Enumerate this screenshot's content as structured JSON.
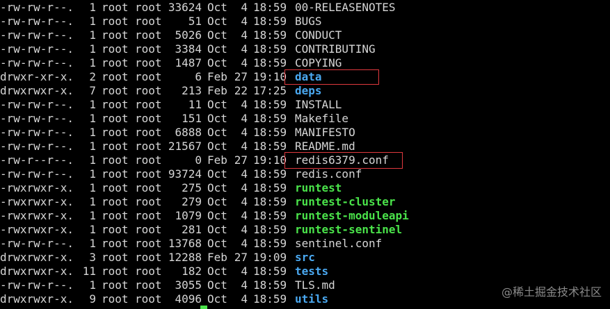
{
  "listing": [
    {
      "perm": "-rw-rw-r--.",
      "links": "1",
      "owner": "root",
      "group": "root",
      "size": "33624",
      "month": "Oct",
      "day": "4",
      "time": "18:59",
      "name": "00-RELEASENOTES",
      "kind": "file"
    },
    {
      "perm": "-rw-rw-r--.",
      "links": "1",
      "owner": "root",
      "group": "root",
      "size": "51",
      "month": "Oct",
      "day": "4",
      "time": "18:59",
      "name": "BUGS",
      "kind": "file"
    },
    {
      "perm": "-rw-rw-r--.",
      "links": "1",
      "owner": "root",
      "group": "root",
      "size": "5026",
      "month": "Oct",
      "day": "4",
      "time": "18:59",
      "name": "CONDUCT",
      "kind": "file"
    },
    {
      "perm": "-rw-rw-r--.",
      "links": "1",
      "owner": "root",
      "group": "root",
      "size": "3384",
      "month": "Oct",
      "day": "4",
      "time": "18:59",
      "name": "CONTRIBUTING",
      "kind": "file"
    },
    {
      "perm": "-rw-rw-r--.",
      "links": "1",
      "owner": "root",
      "group": "root",
      "size": "1487",
      "month": "Oct",
      "day": "4",
      "time": "18:59",
      "name": "COPYING",
      "kind": "file"
    },
    {
      "perm": "drwxr-xr-x.",
      "links": "2",
      "owner": "root",
      "group": "root",
      "size": "6",
      "month": "Feb",
      "day": "27",
      "time": "19:10",
      "name": "data",
      "kind": "dir"
    },
    {
      "perm": "drwxrwxr-x.",
      "links": "7",
      "owner": "root",
      "group": "root",
      "size": "213",
      "month": "Feb",
      "day": "22",
      "time": "17:25",
      "name": "deps",
      "kind": "dir"
    },
    {
      "perm": "-rw-rw-r--.",
      "links": "1",
      "owner": "root",
      "group": "root",
      "size": "11",
      "month": "Oct",
      "day": "4",
      "time": "18:59",
      "name": "INSTALL",
      "kind": "file"
    },
    {
      "perm": "-rw-rw-r--.",
      "links": "1",
      "owner": "root",
      "group": "root",
      "size": "151",
      "month": "Oct",
      "day": "4",
      "time": "18:59",
      "name": "Makefile",
      "kind": "file"
    },
    {
      "perm": "-rw-rw-r--.",
      "links": "1",
      "owner": "root",
      "group": "root",
      "size": "6888",
      "month": "Oct",
      "day": "4",
      "time": "18:59",
      "name": "MANIFESTO",
      "kind": "file"
    },
    {
      "perm": "-rw-rw-r--.",
      "links": "1",
      "owner": "root",
      "group": "root",
      "size": "21567",
      "month": "Oct",
      "day": "4",
      "time": "18:59",
      "name": "README.md",
      "kind": "file"
    },
    {
      "perm": "-rw-r--r--.",
      "links": "1",
      "owner": "root",
      "group": "root",
      "size": "0",
      "month": "Feb",
      "day": "27",
      "time": "19:10",
      "name": "redis6379.conf",
      "kind": "file"
    },
    {
      "perm": "-rw-rw-r--.",
      "links": "1",
      "owner": "root",
      "group": "root",
      "size": "93724",
      "month": "Oct",
      "day": "4",
      "time": "18:59",
      "name": "redis.conf",
      "kind": "file"
    },
    {
      "perm": "-rwxrwxr-x.",
      "links": "1",
      "owner": "root",
      "group": "root",
      "size": "275",
      "month": "Oct",
      "day": "4",
      "time": "18:59",
      "name": "runtest",
      "kind": "exe"
    },
    {
      "perm": "-rwxrwxr-x.",
      "links": "1",
      "owner": "root",
      "group": "root",
      "size": "279",
      "month": "Oct",
      "day": "4",
      "time": "18:59",
      "name": "runtest-cluster",
      "kind": "exe"
    },
    {
      "perm": "-rwxrwxr-x.",
      "links": "1",
      "owner": "root",
      "group": "root",
      "size": "1079",
      "month": "Oct",
      "day": "4",
      "time": "18:59",
      "name": "runtest-moduleapi",
      "kind": "exe"
    },
    {
      "perm": "-rwxrwxr-x.",
      "links": "1",
      "owner": "root",
      "group": "root",
      "size": "281",
      "month": "Oct",
      "day": "4",
      "time": "18:59",
      "name": "runtest-sentinel",
      "kind": "exe"
    },
    {
      "perm": "-rw-rw-r--.",
      "links": "1",
      "owner": "root",
      "group": "root",
      "size": "13768",
      "month": "Oct",
      "day": "4",
      "time": "18:59",
      "name": "sentinel.conf",
      "kind": "file"
    },
    {
      "perm": "drwxrwxr-x.",
      "links": "3",
      "owner": "root",
      "group": "root",
      "size": "12288",
      "month": "Feb",
      "day": "27",
      "time": "19:09",
      "name": "src",
      "kind": "dir"
    },
    {
      "perm": "drwxrwxr-x.",
      "links": "11",
      "owner": "root",
      "group": "root",
      "size": "182",
      "month": "Oct",
      "day": "4",
      "time": "18:59",
      "name": "tests",
      "kind": "dir"
    },
    {
      "perm": "-rw-rw-r--.",
      "links": "1",
      "owner": "root",
      "group": "root",
      "size": "3055",
      "month": "Oct",
      "day": "4",
      "time": "18:59",
      "name": "TLS.md",
      "kind": "file"
    },
    {
      "perm": "drwxrwxr-x.",
      "links": "9",
      "owner": "root",
      "group": "root",
      "size": "4096",
      "month": "Oct",
      "day": "4",
      "time": "18:59",
      "name": "utils",
      "kind": "dir"
    }
  ],
  "watermark": "@稀土掘金技术社区",
  "colors": {
    "background": "#000000",
    "text": "#d6d6d6",
    "directory": "#4aa8f0",
    "executable": "#4ae34a",
    "highlight_border": "#e0393e",
    "cursor": "#4ae34a"
  }
}
